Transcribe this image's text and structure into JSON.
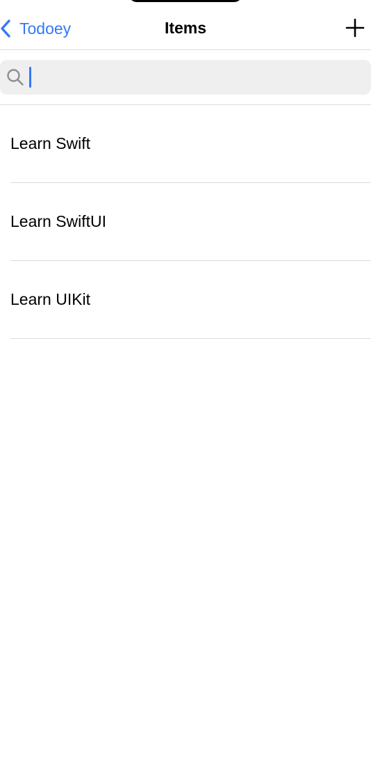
{
  "nav": {
    "back_label": "Todoey",
    "title": "Items",
    "add_icon": "plus-icon",
    "back_icon": "chevron-left-icon"
  },
  "search": {
    "value": "",
    "placeholder": "",
    "icon": "search-icon"
  },
  "items": [
    {
      "label": "Learn Swift"
    },
    {
      "label": "Learn SwiftUI"
    },
    {
      "label": "Learn UIKit"
    }
  ],
  "colors": {
    "accent": "#3478f6",
    "search_background": "#efefef",
    "divider": "#dcdcdc",
    "text": "#000000"
  }
}
